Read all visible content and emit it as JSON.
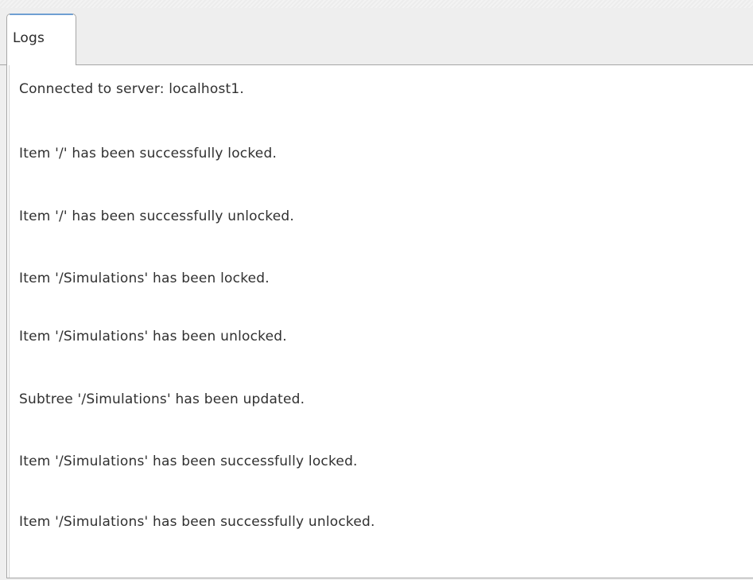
{
  "tabs": [
    {
      "label": "Logs",
      "active": true
    }
  ],
  "logs": [
    "Connected to server: localhost1.",
    "Item '/' has been successfully locked.",
    "Item '/' has been successfully unlocked.",
    "Item '/Simulations' has been locked.",
    "Item '/Simulations' has been unlocked.",
    "Subtree '/Simulations' has been updated.",
    "Item '/Simulations' has been successfully locked.",
    "Item '/Simulations' has been successfully unlocked."
  ],
  "colors": {
    "tab_accent": "#6f9fd2",
    "border": "#a6a6a6",
    "text": "#303030",
    "panel_bg": "#ffffff",
    "chrome_bg": "#eeeeee"
  }
}
